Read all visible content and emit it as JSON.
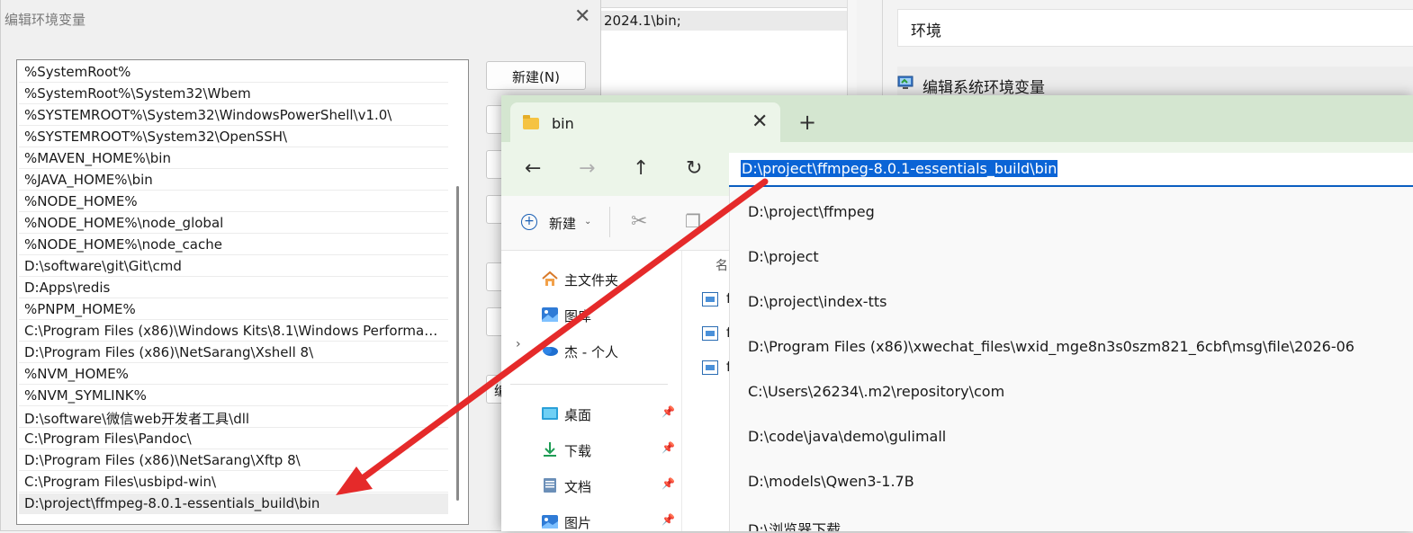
{
  "bg_middle": {
    "selected_text": "2024.1\\bin;"
  },
  "bg_right": {
    "environment_label": "环境",
    "edit_system_env_label": "编辑系统环境变量"
  },
  "edit_dialog": {
    "title": "编辑环境变量",
    "close_glyph": "✕",
    "entries": [
      "%SystemRoot%",
      "%SystemRoot%\\System32\\Wbem",
      "%SYSTEMROOT%\\System32\\WindowsPowerShell\\v1.0\\",
      "%SYSTEMROOT%\\System32\\OpenSSH\\",
      "%MAVEN_HOME%\\bin",
      "%JAVA_HOME%\\bin",
      "%NODE_HOME%",
      "%NODE_HOME%\\node_global",
      "%NODE_HOME%\\node_cache",
      "D:\\software\\git\\Git\\cmd",
      "D:Apps\\redis",
      "%PNPM_HOME%",
      "C:\\Program Files (x86)\\Windows Kits\\8.1\\Windows Performanc...",
      "D:\\Program Files (x86)\\NetSarang\\Xshell 8\\",
      "%NVM_HOME%",
      "%NVM_SYMLINK%",
      "D:\\software\\微信web开发者工具\\dll",
      "C:\\Program Files\\Pandoc\\",
      "D:\\Program Files (x86)\\NetSarang\\Xftp 8\\",
      "C:\\Program Files\\usbipd-win\\",
      "D:\\project\\ffmpeg-8.0.1-essentials_build\\bin"
    ],
    "selected_index": 20,
    "new_button": "新建(N)",
    "partial_button_label": "编"
  },
  "explorer": {
    "tab_label": "bin",
    "tab_close_glyph": "✕",
    "new_tab_glyph": "+",
    "nav": {
      "back": "←",
      "forward": "→",
      "up": "↑",
      "refresh": "↻"
    },
    "address": "D:\\project\\ffmpeg-8.0.1-essentials_build\\bin",
    "suggestions": [
      "D:\\project\\ffmpeg",
      "D:\\project",
      "D:\\project\\index-tts",
      "D:\\Program Files (x86)\\xwechat_files\\wxid_mge8n3s0szm821_6cbf\\msg\\file\\2026-06",
      "C:\\Users\\26234\\.m2\\repository\\com",
      "D:\\code\\java\\demo\\gulimall",
      "D:\\models\\Qwen3-1.7B",
      "D:\\浏览器下载"
    ],
    "command_bar": {
      "new_label": "新建",
      "chevron": "⌄",
      "cut_glyph": "✂",
      "copy_glyph": "❐"
    },
    "nav_pane": {
      "home": "主文件夹",
      "gallery": "图库",
      "personal": "杰 - 个人",
      "expand_glyph": "›",
      "quick_access": [
        {
          "label": "桌面",
          "icon": "desktop-icon"
        },
        {
          "label": "下载",
          "icon": "download-icon"
        },
        {
          "label": "文档",
          "icon": "document-icon"
        },
        {
          "label": "图片",
          "icon": "pictures-icon"
        }
      ],
      "pin_glyph": "📌"
    },
    "file_pane": {
      "column_header": "名",
      "files": [
        "f",
        "f",
        "f"
      ]
    }
  },
  "annotation": {
    "arrow_color": "#e52a2a"
  }
}
